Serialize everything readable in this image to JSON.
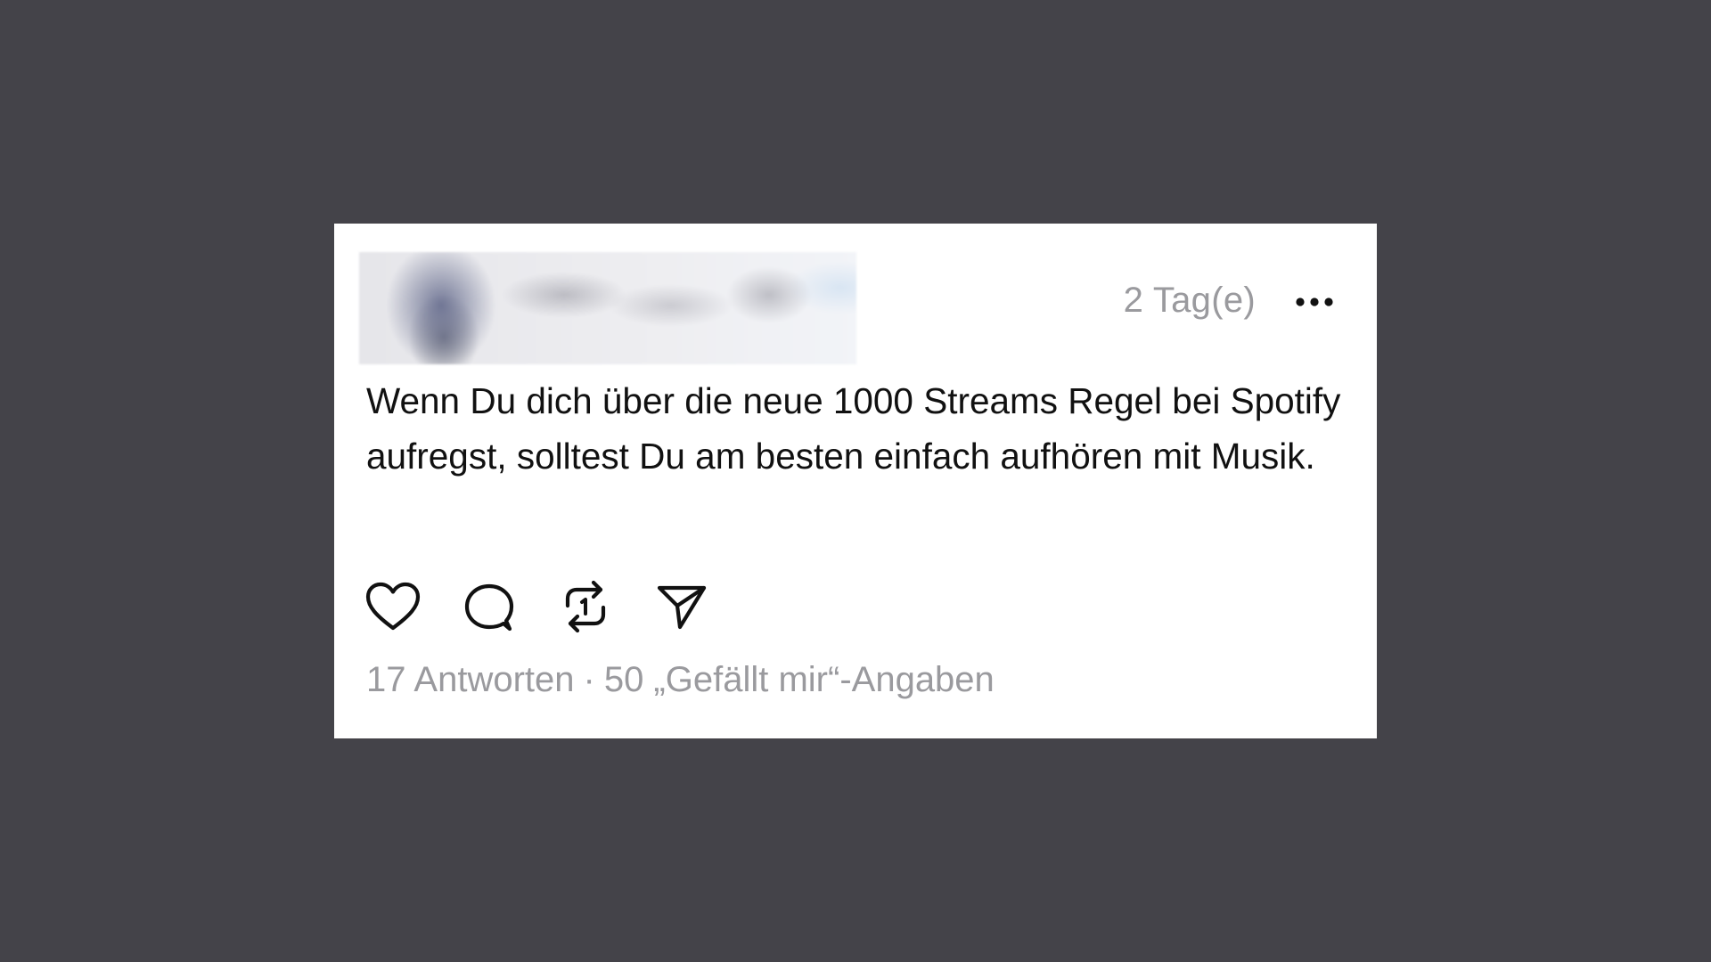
{
  "post": {
    "timestamp": "2 Tag(e)",
    "text": "Wenn Du dich über die neue 1000 Streams Regel bei Spotify aufregst, solltest Du am besten einfach aufhören mit Musik.",
    "replies": "17 Antworten",
    "separator": "·",
    "likes": "50 „Gefällt mir“-Angaben"
  },
  "actions": {
    "like_icon": "heart-icon",
    "reply_icon": "comment-bubble-icon",
    "repost_icon": "repost-icon",
    "share_icon": "paper-plane-icon",
    "more_icon": "ellipsis-icon"
  },
  "colors": {
    "background": "#444349",
    "card": "#ffffff",
    "text": "#111111",
    "muted": "#9a9a9e"
  }
}
